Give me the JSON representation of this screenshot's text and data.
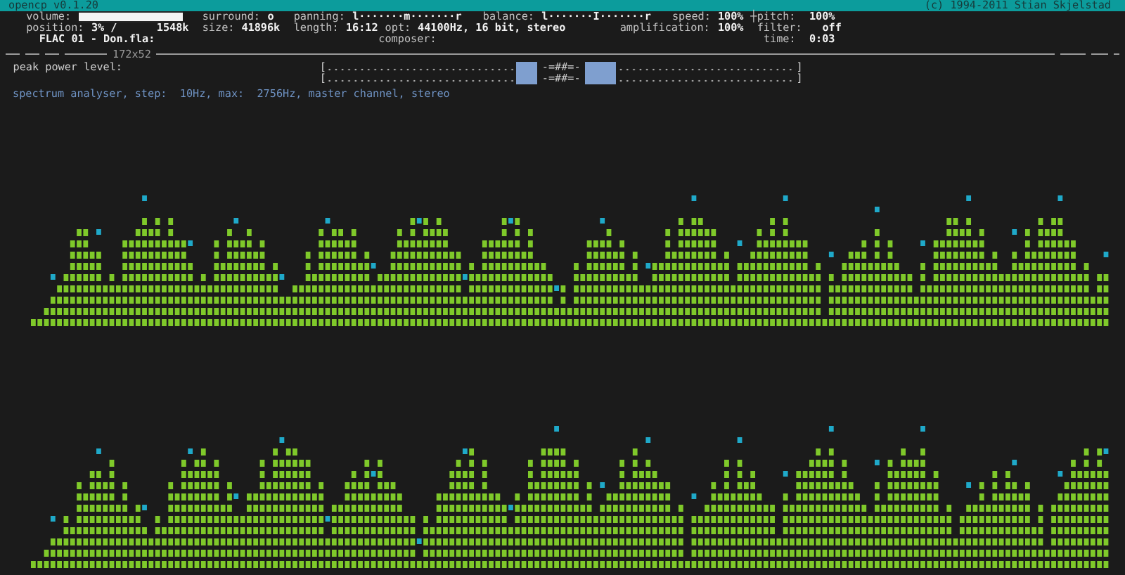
{
  "title_bar": {
    "title": "opencp v0.1.20",
    "copyright": "(c) 1994-2011 Stian Skjelstad"
  },
  "status_rows": [
    [
      {
        "kind": "bar",
        "label": "volume:",
        "level": 1
      },
      {
        "kind": "pair",
        "label": "surround:",
        "value": "o"
      },
      {
        "kind": "pair",
        "label": "panning:",
        "value": "l·······m·······r"
      },
      {
        "kind": "pair",
        "label": "balance:",
        "value": "l·······I·······r"
      },
      {
        "kind": "pair",
        "label": "speed:",
        "value": "100%"
      },
      {
        "kind": "glyph",
        "value": "┼"
      },
      {
        "kind": "pair",
        "label": "pitch:",
        "value": "100%"
      }
    ],
    [
      {
        "kind": "pair",
        "label": "position:",
        "value": "3% /"
      },
      {
        "kind": "value",
        "value": "1548k"
      },
      {
        "kind": "pair",
        "label": "size:",
        "value": "41896k"
      },
      {
        "kind": "pair",
        "label": "length:",
        "value": "16:12"
      },
      {
        "kind": "pair",
        "label": "opt:",
        "value": "44100Hz, 16 bit, stereo"
      },
      {
        "kind": "pair",
        "label": "amplification:",
        "value": "100%"
      },
      {
        "kind": "pair",
        "label": "filter:",
        "value": "off"
      }
    ],
    [
      {
        "kind": "value",
        "value": "FLAC 01 - Don.fla:"
      },
      {
        "kind": "label",
        "label": "composer:"
      },
      {
        "kind": "pair",
        "label": "time:",
        "value": "0:03"
      }
    ]
  ],
  "divider_label": "172x52",
  "peak_power": {
    "label": "peak power level:",
    "meters": [
      {
        "left_cap": "[",
        "left": {
          "level": 0.1
        },
        "center": "-=##=-",
        "right": {
          "level": 0.15
        },
        "right_cap": "]"
      },
      {
        "left_cap": "[",
        "left": {
          "level": 0.1
        },
        "center": "-=##=-",
        "right": {
          "level": 0.15
        },
        "right_cap": "]"
      }
    ]
  },
  "spectrum": {
    "caption": "spectrum analyser, step:  10Hz, max:  2756Hz, master channel, stereo"
  }
}
